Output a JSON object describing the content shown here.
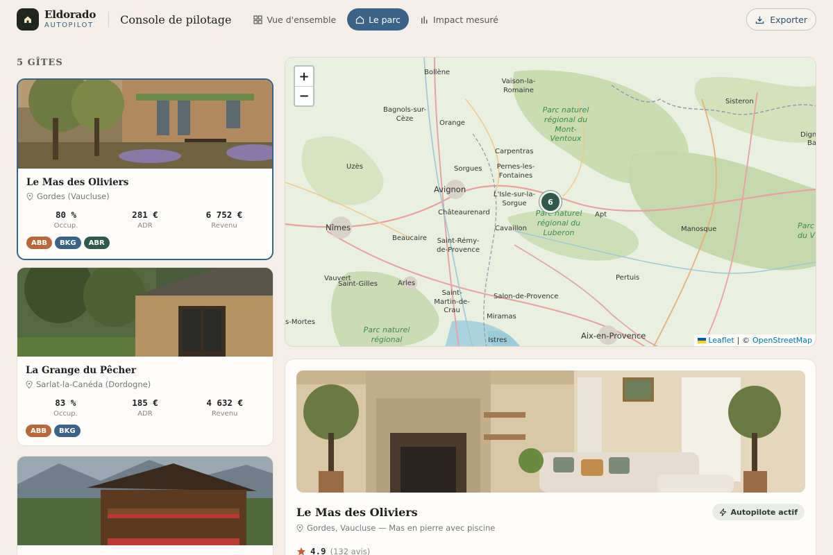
{
  "brand": {
    "name": "Eldorado",
    "sub": "AUTOPILOT"
  },
  "header": {
    "title": "Console de pilotage",
    "tabs": [
      {
        "label": "Vue d'ensemble",
        "icon": "grid-icon",
        "active": false
      },
      {
        "label": "Le parc",
        "icon": "home-icon",
        "active": true
      },
      {
        "label": "Impact mesuré",
        "icon": "bar-chart-icon",
        "active": false
      }
    ],
    "export_label": "Exporter"
  },
  "list": {
    "title": "5 GÎTES",
    "cards": [
      {
        "name": "Le Mas des Oliviers",
        "location": "Gordes (Vaucluse)",
        "metrics": [
          {
            "value": "80 %",
            "label": "Occup."
          },
          {
            "value": "281 €",
            "label": "ADR"
          },
          {
            "value": "6 752 €",
            "label": "Revenu"
          }
        ],
        "badges": [
          "ABB",
          "BKG",
          "ABR"
        ]
      },
      {
        "name": "La Grange du Pêcher",
        "location": "Sarlat-la-Canéda (Dordogne)",
        "metrics": [
          {
            "value": "83 %",
            "label": "Occup."
          },
          {
            "value": "185 €",
            "label": "ADR"
          },
          {
            "value": "4 632 €",
            "label": "Revenu"
          }
        ],
        "badges": [
          "ABB",
          "BKG"
        ]
      }
    ]
  },
  "map": {
    "zoom_in": "+",
    "zoom_out": "−",
    "cluster_count": "6",
    "attribution_leaflet": "Leaflet",
    "attribution_sep": "| ©",
    "attribution_osm": "OpenStreetMap",
    "places": {
      "bollene": "Bollène",
      "vaison": "Vaison-la-Romaine",
      "sisteron": "Sisteron",
      "bagnols": "Bagnols-sur-Cèze",
      "orange": "Orange",
      "pnr_ventoux": "Parc naturel régional du Mont-Ventoux",
      "digne": "Digne",
      "bain": "Bain",
      "carpentras": "Carpentras",
      "uzes": "Uzès",
      "sorgues": "Sorgues",
      "pernes": "Pernes-les-Fontaines",
      "avignon": "Avignon",
      "isle": "L'Isle-sur-la-Sorgue",
      "chateaurenard": "Châteaurenard",
      "pnr_luberon": "Parc naturel régional du Luberon",
      "apt": "Apt",
      "nimes": "Nîmes",
      "cavaillon": "Cavaillon",
      "manosque": "Manosque",
      "parc_edge": "Parc du V",
      "beaucaire": "Beaucaire",
      "saintremy": "Saint-Rémy-de-Provence",
      "vauvert": "Vauvert",
      "saintgilles": "Saint-Gilles",
      "arles": "Arles",
      "pertuis": "Pertuis",
      "saintmartin": "Saint-Martin-de-Crau",
      "salon": "Salon-de-Provence",
      "mortes": "s-Mortes",
      "miramas": "Miramas",
      "pnr_camargue": "Parc naturel régional",
      "istres": "Istres",
      "aix": "Aix-en-Provence"
    }
  },
  "detail": {
    "name": "Le Mas des Oliviers",
    "location": "Gordes, Vaucluse — Mas en pierre avec piscine",
    "status": "Autopilote actif",
    "rating": "4.9",
    "reviews": "(132 avis)"
  },
  "colors": {
    "primary": "#3b6388",
    "badge_abb": "#b8683a",
    "badge_bkg": "#3b6388",
    "badge_abr": "#2f5a4b",
    "cluster": "#2f5a4b",
    "star": "#c0603a"
  }
}
